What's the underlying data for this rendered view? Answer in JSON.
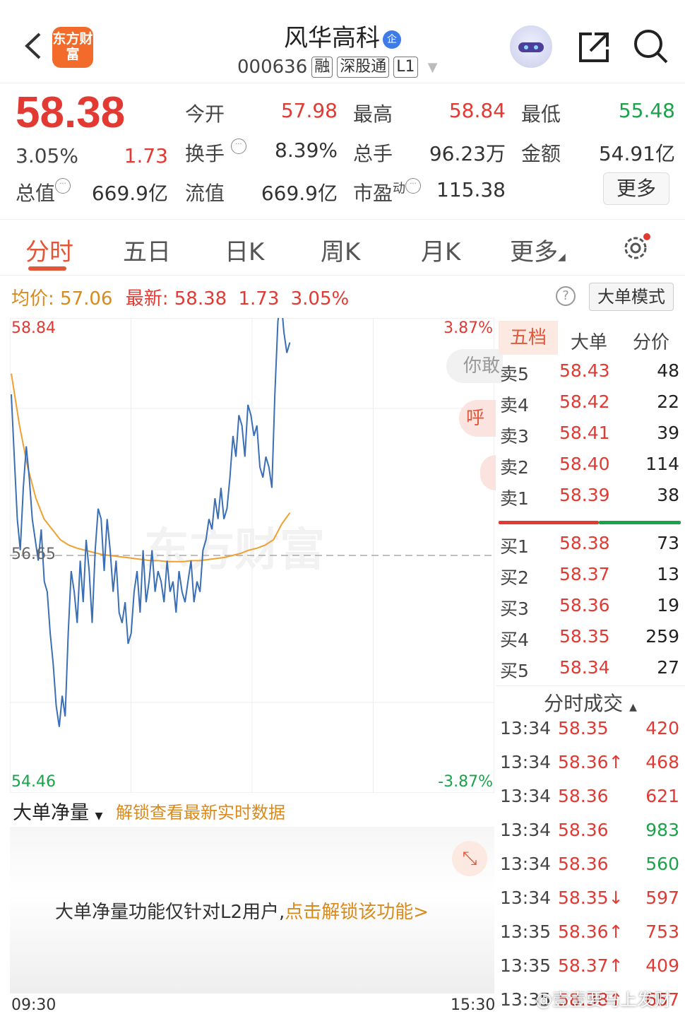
{
  "header": {
    "logo_text": "东方财富",
    "title": "风华高科",
    "title_badge": "企",
    "code": "000636",
    "tags": [
      "融",
      "深股通",
      "L1"
    ]
  },
  "quote": {
    "price": "58.38",
    "change_pct": "3.05%",
    "change": "1.73",
    "open_label": "今开",
    "open": "57.98",
    "high_label": "最高",
    "high": "58.84",
    "low_label": "最低",
    "low": "55.48",
    "turnover_label": "换手",
    "turnover": "8.39%",
    "volume_label": "总手",
    "volume": "96.23万",
    "amount_label": "金额",
    "amount": "54.91亿",
    "mktcap_label": "总值",
    "mktcap": "669.9亿",
    "float_label": "流值",
    "float": "669.9亿",
    "pe_label": "市盈",
    "pe_sup": "动",
    "pe": "115.38",
    "more": "更多"
  },
  "tabs": [
    "分时",
    "五日",
    "日K",
    "周K",
    "月K",
    "更多"
  ],
  "info_line": {
    "avg_label": "均价:",
    "avg": "57.06",
    "latest_label": "最新:",
    "latest": "58.38",
    "chg": "1.73",
    "pct": "3.05%",
    "big_mode": "大单模式",
    "help": "?"
  },
  "chart_data": {
    "type": "line",
    "title": "",
    "xlabel": "",
    "ylabel": "",
    "ylim": [
      54.46,
      58.84
    ],
    "y_top": "58.84",
    "y_mid": "56.65",
    "y_bottom": "54.46",
    "pct_top": "3.87%",
    "pct_bottom": "-3.87%",
    "x_start": "09:30",
    "x_end": "15:30",
    "series": [
      {
        "color": "#3a6fb5",
        "values": [
          58.2,
          57.6,
          57.0,
          56.7,
          57.3,
          57.7,
          57.4,
          57.0,
          56.8,
          56.6,
          56.9,
          56.4,
          56.3,
          55.9,
          55.6,
          55.2,
          55.0,
          55.3,
          55.1,
          55.9,
          56.5,
          56.3,
          56.0,
          56.6,
          56.2,
          56.8,
          56.5,
          56.0,
          56.7,
          57.1,
          57.0,
          56.5,
          57.0,
          56.7,
          56.3,
          56.6,
          56.1,
          56.0,
          56.2,
          55.8,
          55.9,
          56.3,
          56.5,
          56.1,
          56.7,
          56.2,
          56.4,
          56.7,
          56.3,
          56.5,
          56.4,
          56.2,
          56.6,
          56.3,
          56.4,
          56.1,
          56.5,
          56.3,
          56.2,
          56.4,
          56.6,
          56.2,
          56.4,
          56.3,
          56.7,
          56.8,
          57.0,
          56.9,
          57.2,
          57.0,
          57.3,
          57.0,
          57.1,
          57.4,
          57.8,
          57.6,
          58.0,
          57.9,
          57.6,
          58.1,
          58.0,
          57.8,
          57.9,
          57.5,
          57.4,
          57.6,
          57.5,
          57.3,
          58.2,
          58.9,
          59.2,
          58.8,
          58.6,
          58.7
        ]
      },
      {
        "color": "#f0a030",
        "values": [
          58.4,
          57.9,
          57.5,
          57.2,
          57.0,
          56.9,
          56.8,
          56.75,
          56.72,
          56.7,
          56.68,
          56.66,
          56.65,
          56.64,
          56.63,
          56.62,
          56.61,
          56.6,
          56.6,
          56.59,
          56.59,
          56.59,
          56.6,
          56.6,
          56.61,
          56.62,
          56.63,
          56.65,
          56.67,
          56.7,
          56.72,
          56.75,
          56.8,
          56.95,
          57.06
        ]
      }
    ]
  },
  "book": {
    "tabs": [
      "五档",
      "大单",
      "分价"
    ],
    "asks": [
      {
        "label": "卖5",
        "price": "58.43",
        "vol": "48"
      },
      {
        "label": "卖4",
        "price": "58.42",
        "vol": "22"
      },
      {
        "label": "卖3",
        "price": "58.41",
        "vol": "39"
      },
      {
        "label": "卖2",
        "price": "58.40",
        "vol": "114"
      },
      {
        "label": "卖1",
        "price": "58.39",
        "vol": "38"
      }
    ],
    "bids": [
      {
        "label": "买1",
        "price": "58.38",
        "vol": "73"
      },
      {
        "label": "买2",
        "price": "58.37",
        "vol": "13"
      },
      {
        "label": "买3",
        "price": "58.36",
        "vol": "19"
      },
      {
        "label": "买4",
        "price": "58.35",
        "vol": "259"
      },
      {
        "label": "买5",
        "price": "58.34",
        "vol": "27"
      }
    ],
    "ask_ratio": 0.55,
    "trade_title": "分时成交",
    "trades": [
      {
        "time": "13:34",
        "price": "58.35",
        "vol": "420",
        "color": "#e23a33"
      },
      {
        "time": "13:34",
        "price": "58.36↑",
        "vol": "468",
        "color": "#e23a33"
      },
      {
        "time": "13:34",
        "price": "58.36",
        "vol": "621",
        "color": "#e23a33"
      },
      {
        "time": "13:34",
        "price": "58.36",
        "vol": "983",
        "color": "#1aa34a"
      },
      {
        "time": "13:34",
        "price": "58.36",
        "vol": "560",
        "color": "#1aa34a"
      },
      {
        "time": "13:34",
        "price": "58.35↓",
        "vol": "597",
        "color": "#e23a33"
      },
      {
        "time": "13:35",
        "price": "58.36↑",
        "vol": "753",
        "color": "#e23a33"
      },
      {
        "time": "13:35",
        "price": "58.37↑",
        "vol": "409",
        "color": "#e23a33"
      },
      {
        "time": "13:35",
        "price": "58.38↑",
        "vol": "657",
        "color": "#e23a33"
      }
    ]
  },
  "big_order": {
    "label": "大单净量",
    "unlock_link": "解锁查看最新实时数据",
    "msg": "大单净量功能仅针对L2用户,",
    "msg_link": "点击解锁该功能>"
  },
  "watermark": "@壹壹要马上发财",
  "chart_watermark": "东方财富",
  "side_bubbles": [
    "你敢",
    "呼"
  ],
  "colors": {
    "up": "#e23a33",
    "down": "#1aa34a",
    "accent": "#e2573a"
  }
}
